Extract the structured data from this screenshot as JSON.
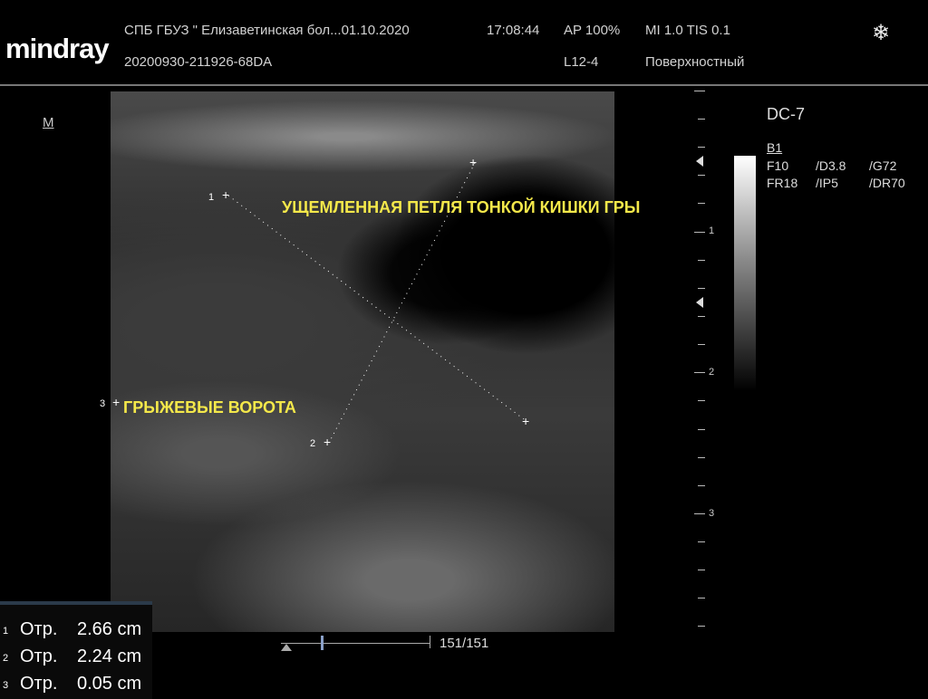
{
  "header": {
    "brand": "mindray",
    "institution": "СПБ  ГБУЗ \" Елизаветинская бол...01.10.2020",
    "time": "17:08:44",
    "ap": "AP  100%",
    "mi_tis": "MI 1.0 TIS 0.1",
    "exam_id": "20200930-211926-68DA",
    "probe": "L12-4",
    "preset": "Поверхностный",
    "freeze_icon": "snowflake-icon"
  },
  "image": {
    "mode_label": "M",
    "annotations": {
      "loop": "УЩЕМЛЕННАЯ ПЕТЛЯ ТОНКОЙ КИШКИ  ГРЫ",
      "gate": "ГРЫЖЕВЫЕ ВОРОТА"
    },
    "caliper_numbers": [
      "1",
      "2",
      "3"
    ]
  },
  "depth_scale": {
    "labels": [
      "1",
      "2",
      "3"
    ]
  },
  "right_panel": {
    "device": "DC-7",
    "mode": "B1",
    "row1": [
      "F10",
      "/D3.8",
      "/G72"
    ],
    "row2": [
      "FR18",
      "/IP5",
      "/DR70"
    ]
  },
  "measurements": [
    {
      "index": "1",
      "label": "Отр.",
      "value": "2.66 cm"
    },
    {
      "index": "2",
      "label": "Отр.",
      "value": "2.24 cm"
    },
    {
      "index": "3",
      "label": "Отр.",
      "value": "0.05 cm"
    }
  ],
  "cine": {
    "frames": "151/151"
  }
}
